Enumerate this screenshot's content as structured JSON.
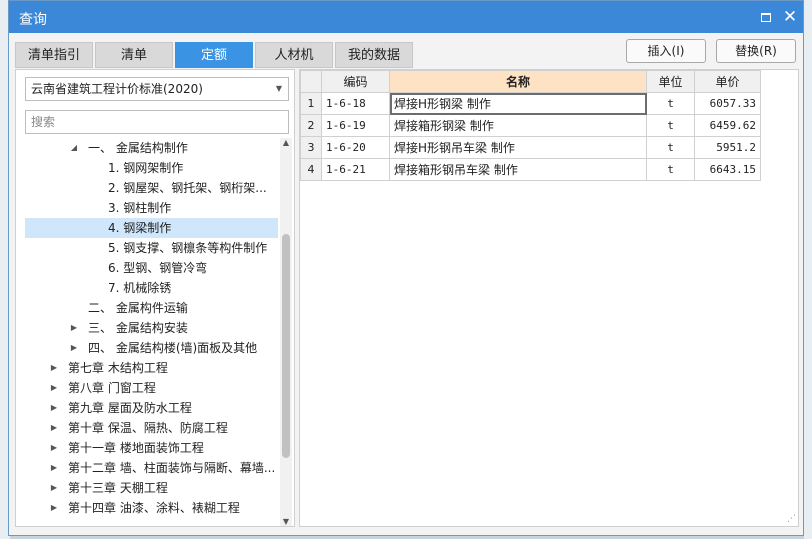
{
  "dialog": {
    "title": "查询"
  },
  "tabs": [
    "清单指引",
    "清单",
    "定额",
    "人材机",
    "我的数据"
  ],
  "active_tab": 2,
  "buttons": {
    "insert": "插入(I)",
    "replace": "替换(R)"
  },
  "standard_select": {
    "value": "云南省建筑工程计价标准(2020)"
  },
  "search": {
    "placeholder": "搜索"
  },
  "tree": [
    {
      "label": "一、 金属结构制作",
      "level": 2,
      "expander": "open"
    },
    {
      "label": "1. 钢网架制作",
      "level": 3
    },
    {
      "label": "2. 钢屋架、钢托架、钢桁架...",
      "level": 3
    },
    {
      "label": "3. 钢柱制作",
      "level": 3
    },
    {
      "label": "4. 钢梁制作",
      "level": 3,
      "selected": true
    },
    {
      "label": "5. 钢支撑、钢檩条等构件制作",
      "level": 3
    },
    {
      "label": "6. 型钢、钢管冷弯",
      "level": 3
    },
    {
      "label": "7. 机械除锈",
      "level": 3
    },
    {
      "label": "二、 金属构件运输",
      "level": 2
    },
    {
      "label": "三、 金属结构安装",
      "level": 2,
      "expander": "closed"
    },
    {
      "label": "四、 金属结构楼(墙)面板及其他",
      "level": 2,
      "expander": "closed"
    },
    {
      "label": "第七章 木结构工程",
      "level": 1,
      "expander": "closed"
    },
    {
      "label": "第八章 门窗工程",
      "level": 1,
      "expander": "closed"
    },
    {
      "label": "第九章 屋面及防水工程",
      "level": 1,
      "expander": "closed"
    },
    {
      "label": "第十章 保温、隔热、防腐工程",
      "level": 1,
      "expander": "closed"
    },
    {
      "label": "第十一章 楼地面装饰工程",
      "level": 1,
      "expander": "closed"
    },
    {
      "label": "第十二章 墙、柱面装饰与隔断、幕墙...",
      "level": 1,
      "expander": "closed"
    },
    {
      "label": "第十三章 天棚工程",
      "level": 1,
      "expander": "closed"
    },
    {
      "label": "第十四章 油漆、涂料、裱糊工程",
      "level": 1,
      "expander": "closed"
    }
  ],
  "table": {
    "headers": {
      "code": "编码",
      "name": "名称",
      "unit": "单位",
      "price": "单价"
    },
    "rows": [
      {
        "num": "1",
        "code": "1-6-18",
        "name": "焊接H形钢梁 制作",
        "unit": "t",
        "price": "6057.33"
      },
      {
        "num": "2",
        "code": "1-6-19",
        "name": "焊接箱形钢梁 制作",
        "unit": "t",
        "price": "6459.62"
      },
      {
        "num": "3",
        "code": "1-6-20",
        "name": "焊接H形钢吊车梁 制作",
        "unit": "t",
        "price": "5951.2"
      },
      {
        "num": "4",
        "code": "1-6-21",
        "name": "焊接箱形钢吊车梁 制作",
        "unit": "t",
        "price": "6643.15"
      }
    ]
  },
  "icons": {
    "maximize": "maximize-icon",
    "close": "close-icon",
    "dropdown": "chevron-down-icon",
    "expander_open": "triangle-down-icon",
    "expander_closed": "triangle-right-icon"
  },
  "colors": {
    "title_bar": "#3b87d8",
    "active_tab": "#3b93e4",
    "selected_row": "#cfe6fb",
    "name_header": "#fde3c4"
  }
}
